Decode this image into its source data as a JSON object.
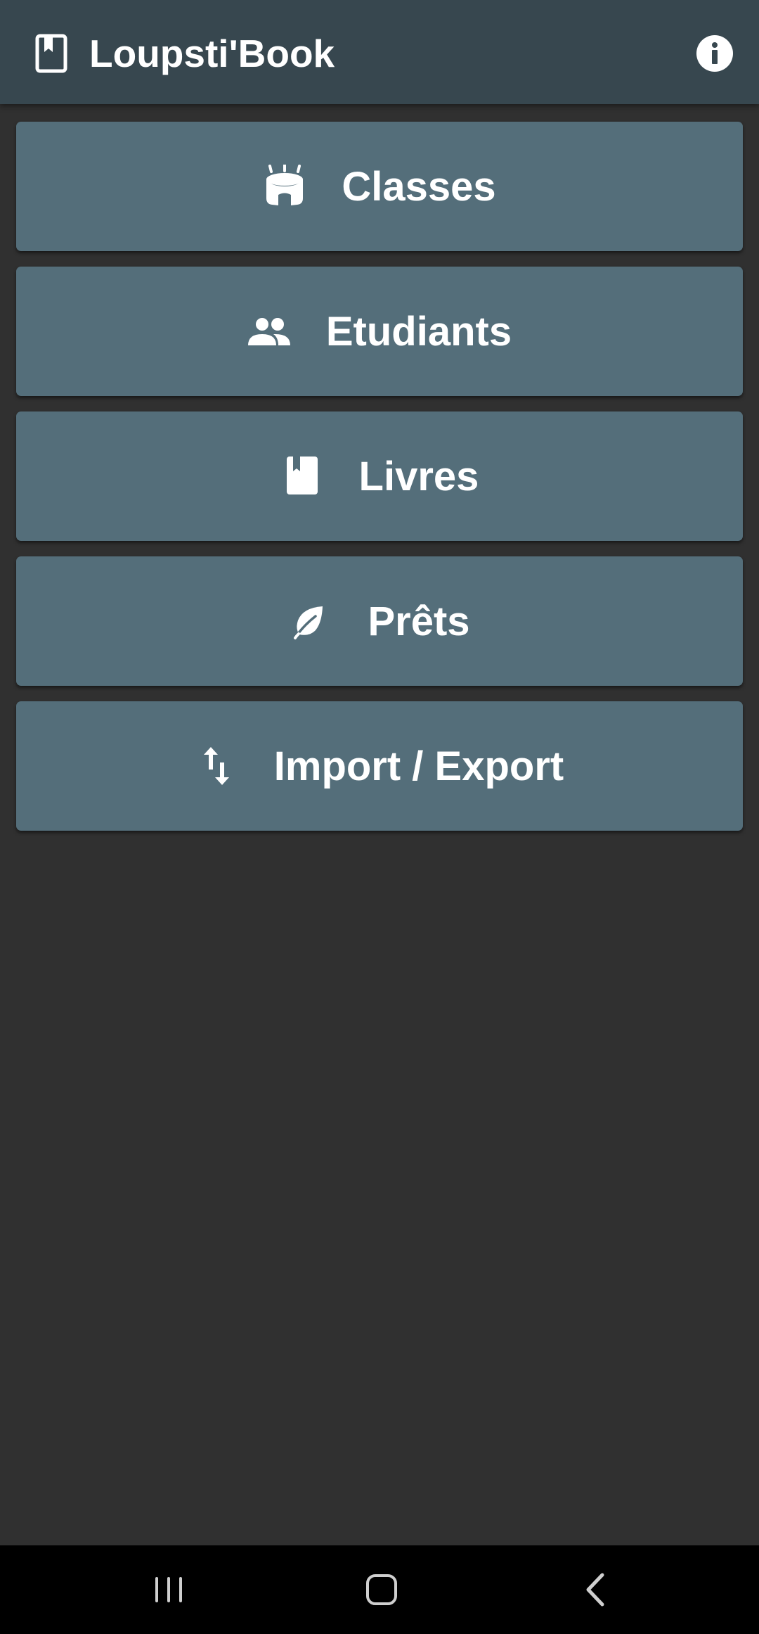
{
  "appbar": {
    "title": "Loupsti'Book",
    "logo_icon": "bookmark-book-icon",
    "info_icon": "info-icon",
    "background": "#37474f"
  },
  "menu": {
    "button_color": "#546e7a",
    "items": [
      {
        "label": "Classes",
        "icon": "stadium-icon"
      },
      {
        "label": "Etudiants",
        "icon": "people-icon"
      },
      {
        "label": "Livres",
        "icon": "book-icon"
      },
      {
        "label": "Prêts",
        "icon": "leaf-icon"
      },
      {
        "label": "Import / Export",
        "icon": "swap-vertical-icon"
      }
    ]
  },
  "navbar": {
    "buttons": [
      "recent-apps-icon",
      "home-icon",
      "back-icon"
    ]
  }
}
